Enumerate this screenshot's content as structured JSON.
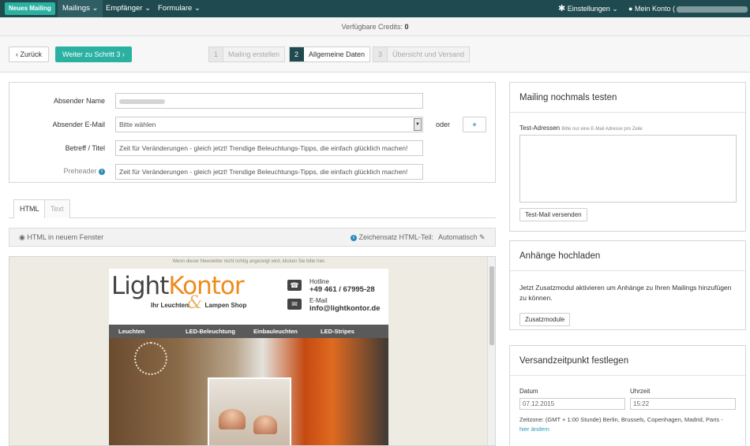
{
  "nav": {
    "new_mailing": "Neues Mailing",
    "menus": [
      "Mailings",
      "Empfänger",
      "Formulare"
    ],
    "settings": "Einstellungen",
    "account_prefix": "Mein Konto (",
    "account_suffix": ")"
  },
  "credits": {
    "label": "Verfügbare Credits:",
    "value": "0"
  },
  "steps": {
    "back": "Zurück",
    "next": "Weiter zu Schritt 3",
    "items": [
      {
        "num": "1",
        "label": "Mailing erstellen"
      },
      {
        "num": "2",
        "label": "Allgemeine Daten"
      },
      {
        "num": "3",
        "label": "Übersicht und Versand"
      }
    ]
  },
  "form": {
    "sender_name_label": "Absender Name",
    "sender_email_label": "Absender E-Mail",
    "sender_email_value": "Bitte wählen",
    "or": "oder",
    "add": "+",
    "subject_label": "Betreff / Titel",
    "subject_value": "Zeit für Veränderungen - gleich jetzt! Trendige Beleuchtungs-Tipps, die einfach glücklich machen!",
    "preheader_label": "Preheader",
    "preheader_value": "Zeit für Veränderungen - gleich jetzt! Trendige Beleuchtungs-Tipps, die einfach glücklich machen!"
  },
  "tabs": [
    "HTML",
    "Text"
  ],
  "toolbar": {
    "open_window": "HTML in neuem Fenster",
    "charset_label": "Zeichensatz HTML-Teil:",
    "charset_value": "Automatisch"
  },
  "newsletter": {
    "note": "Wenn dieser Newsletter nicht richtig angezeigt wird, klicken Sie bitte hier.",
    "logo_light": "Light",
    "logo_kontor": "Kontor",
    "tagline_left": "Ihr Leuchten",
    "tagline_right": "Lampen Shop",
    "hotline_label": "Hotline",
    "hotline": "+49 461 / 67995-28",
    "email_label": "E-Mail",
    "email": "info@lightkontor.de",
    "menu": [
      "Leuchten",
      "LED-Beleuchtung",
      "Einbauleuchten",
      "LED-Stripes"
    ]
  },
  "test_panel": {
    "title": "Mailing nochmals testen",
    "label": "Test-Adressen",
    "hint": "Bitte nur eine E-Mail Adresse pro Zeile",
    "button": "Test-Mail versenden"
  },
  "attach_panel": {
    "title": "Anhänge hochladen",
    "text": "Jetzt Zusatzmodul aktivieren um Anhänge zu Ihren Mailings hinzufügen zu können.",
    "button": "Zusatzmodule"
  },
  "schedule_panel": {
    "title": "Versandzeitpunkt festlegen",
    "date_label": "Datum",
    "date_value": "07.12.2015",
    "time_label": "Uhrzeit",
    "time_value": "15:22",
    "timezone": "Zeitzone: (GMT + 1:00 Stunde) Berlin, Brussels, Copenhagen, Madrid, Paris -",
    "change_link": "hier ändern"
  }
}
